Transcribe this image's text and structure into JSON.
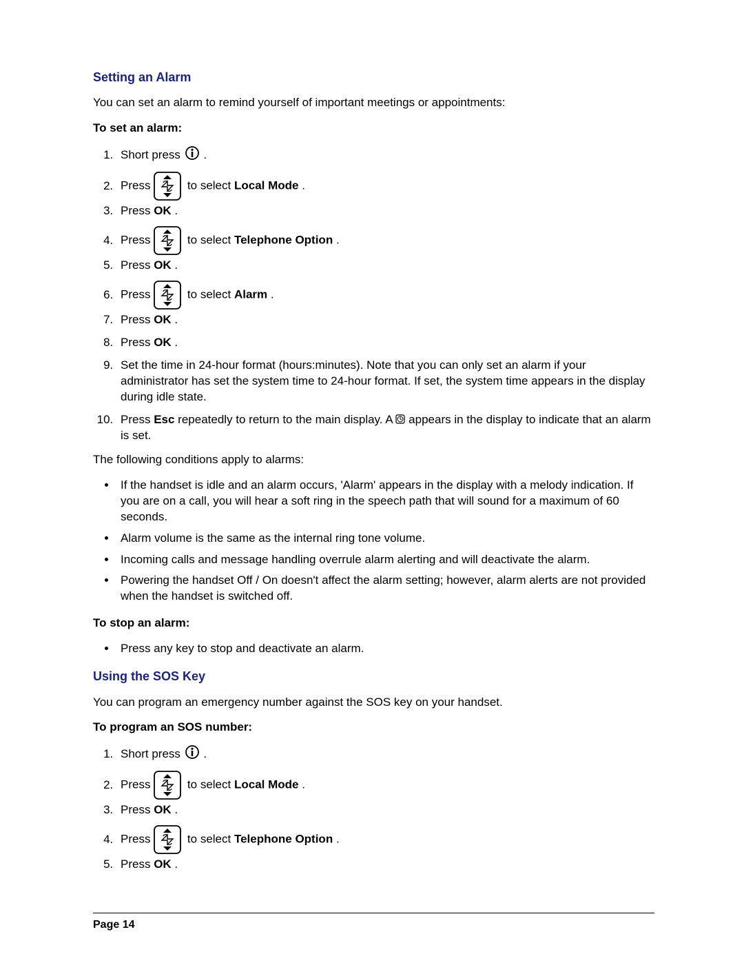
{
  "section1": {
    "heading": "Setting an Alarm",
    "intro": "You can set an alarm to remind yourself of important meetings or appointments:",
    "subhead_set": "To set an alarm:",
    "steps": {
      "s1a": "Short press ",
      "s1b": ".",
      "s2a": "Press ",
      "s2b": " to select ",
      "s2c": "Local Mode",
      "s2d": ".",
      "s3a": "Press ",
      "s3b": "OK",
      "s3c": ".",
      "s4a": "Press ",
      "s4b": " to select ",
      "s4c": "Telephone Option",
      "s4d": ".",
      "s5a": "Press ",
      "s5b": "OK",
      "s5c": ".",
      "s6a": "Press ",
      "s6b": " to select ",
      "s6c": "Alarm",
      "s6d": ".",
      "s7a": "Press ",
      "s7b": "OK",
      "s7c": ".",
      "s8a": "Press ",
      "s8b": "OK",
      "s8c": ".",
      "s9": "Set the time in 24-hour format (hours:minutes). Note that you can only set an alarm if your administrator has set the system time to 24-hour format. If set, the system time appears in the display during idle state.",
      "s10a": "Press ",
      "s10b": "Esc",
      "s10c": " repeatedly to return to the main display. A ",
      "s10d": " appears in the display to indicate that an alarm is set."
    },
    "conditions_intro": "The following conditions apply to alarms:",
    "bullets": {
      "b1": "If the handset is idle and an alarm occurs,  'Alarm' appears in the display with a melody indication. If you are on a call, you will hear a soft ring in the speech path that will sound for a maximum of 60 seconds.",
      "b2": "Alarm volume is the same as the internal ring tone volume.",
      "b3": "Incoming calls and message handling overrule alarm alerting and will deactivate the alarm.",
      "b4": "Powering the handset Off / On doesn't affect the alarm setting; however, alarm alerts are not provided when the handset is switched off."
    },
    "subhead_stop": "To stop an alarm:",
    "stop_bullet": "Press any key to stop and deactivate an alarm."
  },
  "section2": {
    "heading": "Using the SOS Key",
    "intro": "You can program an emergency number against the SOS key on your handset.",
    "subhead": "To program an SOS number:",
    "steps": {
      "s1a": "Short press ",
      "s1b": ".",
      "s2a": "Press ",
      "s2b": " to select ",
      "s2c": "Local Mode",
      "s2d": ".",
      "s3a": "Press ",
      "s3b": "OK",
      "s3c": ".",
      "s4a": "Press ",
      "s4b": " to select ",
      "s4c": "Telephone Option",
      "s4d": ".",
      "s5a": "Press ",
      "s5b": "OK",
      "s5c": "."
    }
  },
  "footer": "Page 14"
}
